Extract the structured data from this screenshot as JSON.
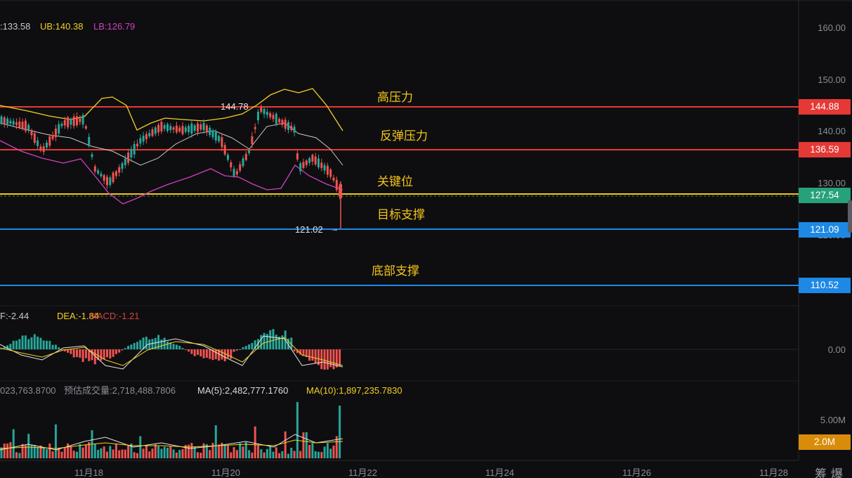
{
  "boll_header": {
    "mid": ":133.58",
    "ub": "UB:140.38",
    "lb": "LB:126.79"
  },
  "macd_header": {
    "dif": "F:-2.44",
    "dea": "DEA:-1.84",
    "macd": "MACD:-1.21"
  },
  "volume_header": {
    "vol": "023,763.8700",
    "estimate": "预估成交量:2,718,488.7806",
    "ma5": "MA(5):2,482,777.1760",
    "ma10": "MA(10):1,897,235.7830"
  },
  "price_axis": [
    "160.00",
    "150.00",
    "140.00",
    "130.00",
    "120.00"
  ],
  "macd_axis": "0.00",
  "volume_axis": "5.00M",
  "volume_tag": "2.0M",
  "price_tags": {
    "high_resistance": "144.88",
    "rebound_resistance": "136.59",
    "current": "127.54",
    "target_support": "121.09",
    "bottom_support": "110.52"
  },
  "markers": {
    "high": "144.78",
    "low": "121.02"
  },
  "annotations": {
    "high_resistance": "高压力",
    "rebound_resistance": "反弹压力",
    "key_level": "关键位",
    "target_support": "目标支撑",
    "bottom_support": "底部支撑"
  },
  "dates": [
    "11月18",
    "11月20",
    "11月22",
    "11月24",
    "11月26",
    "11月28"
  ],
  "bottom_icons": "筹爆",
  "colors": {
    "background": "#0e0e10",
    "up": "#26a69a",
    "down": "#ef5350",
    "resistance_line": "#e53935",
    "support_line": "#1e88e5",
    "key_line": "#f5c518",
    "current_tag": "#26a17b",
    "boll_ub": "#f5d020",
    "boll_lb": "#d040c0",
    "boll_mid": "#c8c8c8",
    "annotation": "#f5c518"
  }
}
